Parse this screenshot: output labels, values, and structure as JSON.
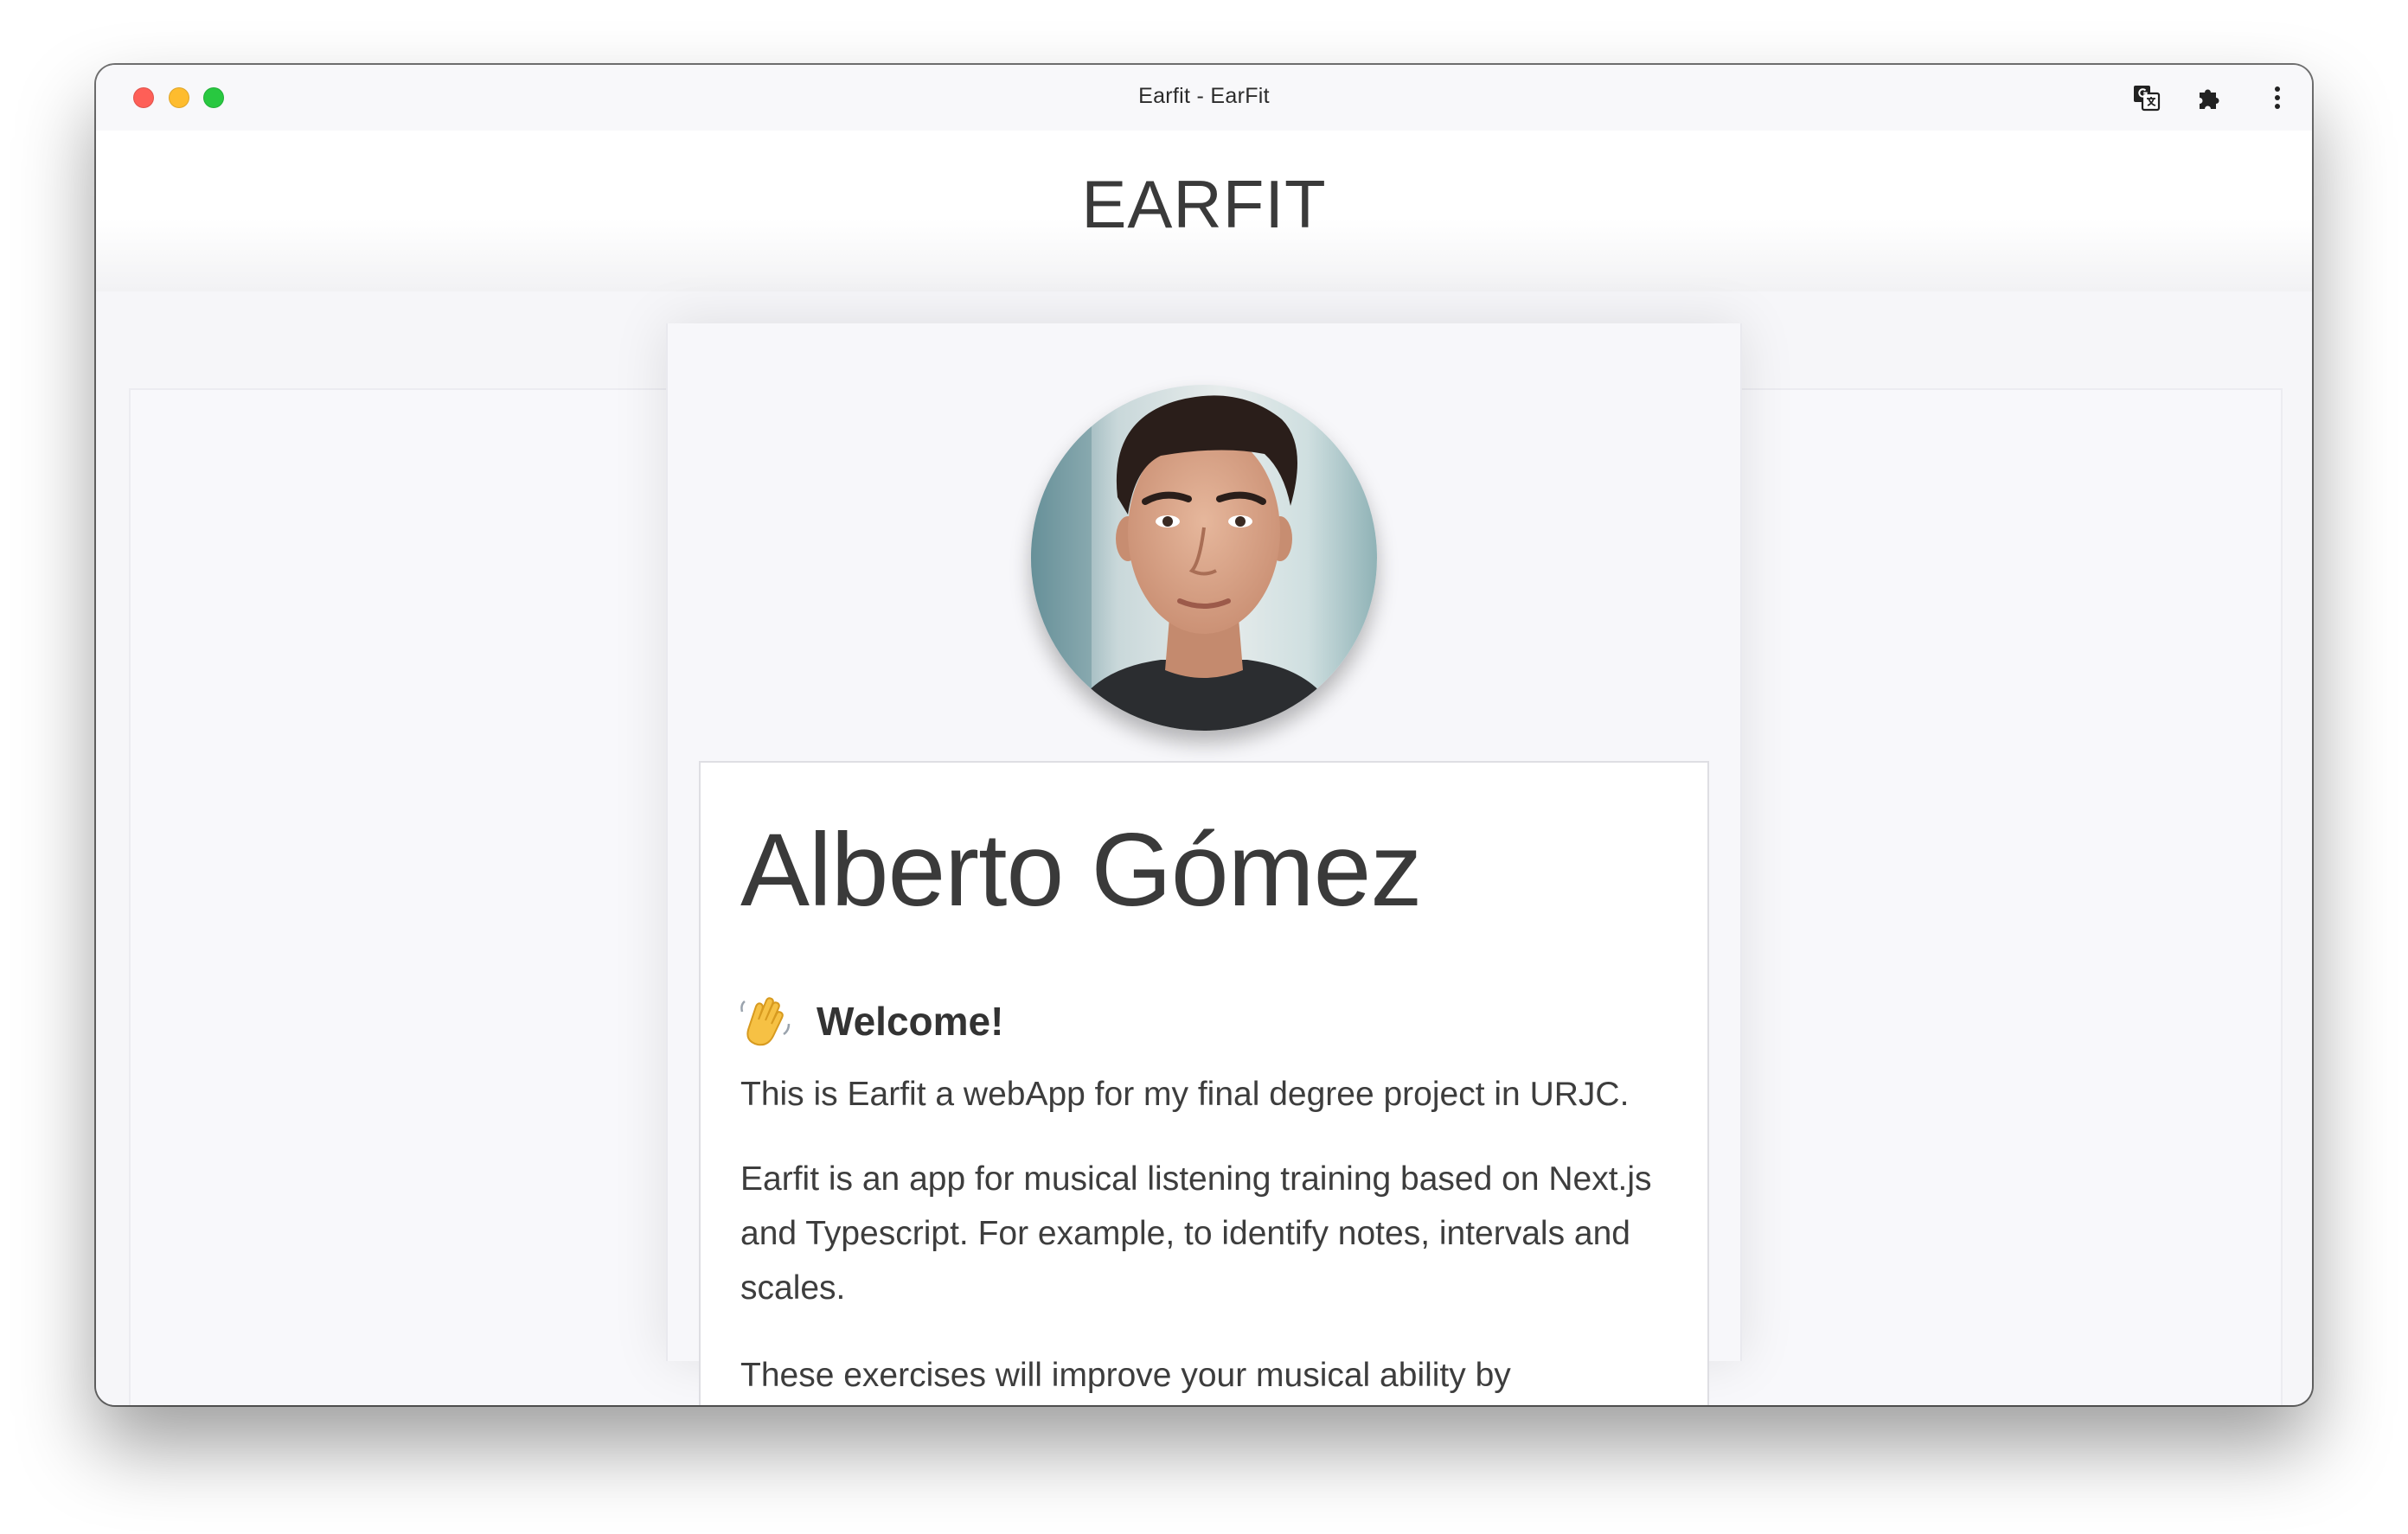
{
  "window": {
    "title": "Earfit - EarFit"
  },
  "toolbar": {
    "icons": [
      "translate-icon",
      "extensions-puzzle-icon",
      "more-vert-icon"
    ]
  },
  "site": {
    "title": "EARFIT"
  },
  "profile": {
    "name": "Alberto Gómez",
    "avatar_alt": "profile-photo",
    "welcome_icon": "waving-hand-icon",
    "welcome": "Welcome!",
    "paragraphs": [
      "This is Earfit a webApp for my final degree project in URJC.",
      "Earfit is an app for musical listening training based on Next.js and Typescript. For example, to identify notes, intervals and scales.",
      "These exercises will improve your musical ability by developing"
    ]
  },
  "colors": {
    "close": "#fe5f57",
    "minimize": "#febc2e",
    "zoom": "#28c840",
    "text": "#3a3a3a"
  }
}
